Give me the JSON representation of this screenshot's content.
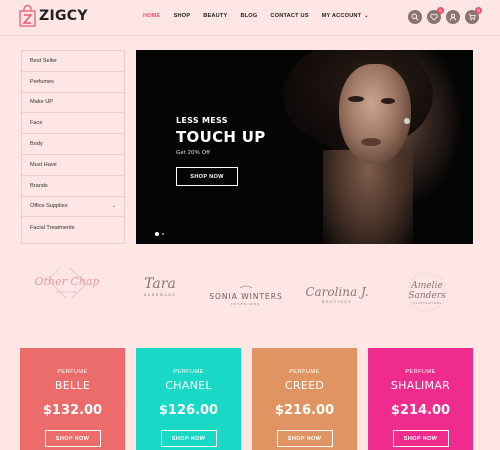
{
  "header": {
    "logo": "ZIGCY",
    "nav": [
      {
        "label": "HOME",
        "active": true
      },
      {
        "label": "SHOP",
        "active": false
      },
      {
        "label": "BEAUTY",
        "active": false
      },
      {
        "label": "BLOG",
        "active": false
      },
      {
        "label": "CONTACT US",
        "active": false
      },
      {
        "label": "MY ACCOUNT",
        "active": false
      }
    ],
    "wishlist_count": "0",
    "cart_count": "0",
    "colors": {
      "accent": "#e8556b",
      "icon_bg": "#8c7370"
    }
  },
  "sidebar": {
    "items": [
      {
        "label": "Best Seller"
      },
      {
        "label": "Perfumes"
      },
      {
        "label": "Make UP"
      },
      {
        "label": "Face"
      },
      {
        "label": "Body"
      },
      {
        "label": "Must Have"
      },
      {
        "label": "Brands"
      },
      {
        "label": "Office Supplies"
      },
      {
        "label": "Facial Treatments"
      }
    ]
  },
  "hero": {
    "subtitle": "LESS MESS",
    "title": "TOUCH UP",
    "offer": "Get 20% Off",
    "button": "SHOP NOW"
  },
  "brands": [
    {
      "name": "Other Chap",
      "tag": "FASHION"
    },
    {
      "name": "Tara",
      "tag": "HANDMADE"
    },
    {
      "name": "SONIA WINTERS",
      "tag": "INTERIORS"
    },
    {
      "name": "Carolina J.",
      "tag": "BOUTIQUE"
    },
    {
      "name": "Amelie Sanders",
      "tag": "ILLUSTRATIONS"
    }
  ],
  "products": [
    {
      "category": "PERFUME",
      "name": "BELLE",
      "price": "$132.00",
      "button": "SHOP NOW",
      "color": "#ec6b6b"
    },
    {
      "category": "PERFUME",
      "name": "CHANEL",
      "price": "$126.00",
      "button": "SHOP NOW",
      "color": "#19d8c6"
    },
    {
      "category": "PERFUME",
      "name": "CREED",
      "price": "$216.00",
      "button": "SHOP NOW",
      "color": "#e09461"
    },
    {
      "category": "PERFUME",
      "name": "SHALIMAR",
      "price": "$214.00",
      "button": "SHOP NOW",
      "color": "#ef2c8e"
    }
  ]
}
